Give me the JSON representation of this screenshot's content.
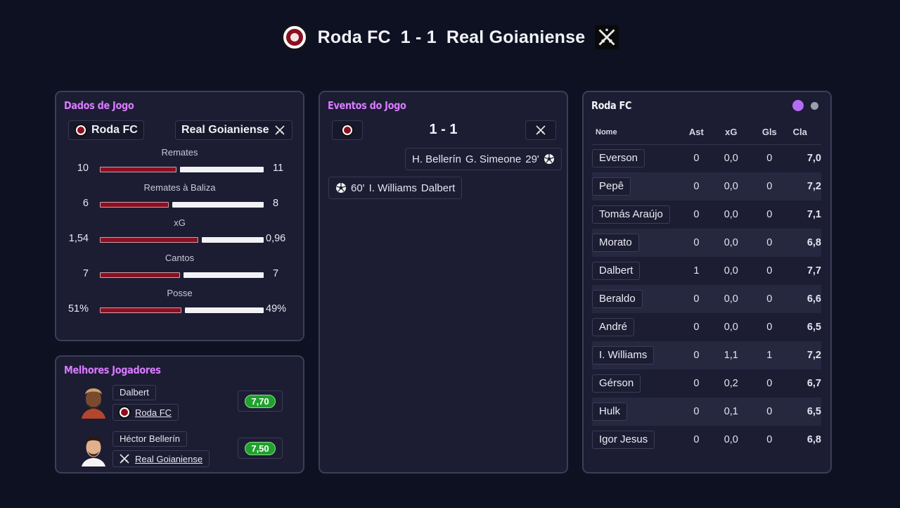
{
  "match": {
    "home": "Roda FC",
    "away": "Real Goianiense",
    "score": "1 - 1"
  },
  "stats_panel": {
    "title": "Dados de Jogo",
    "home_chip": "Roda FC",
    "away_chip": "Real Goianiense",
    "stats": [
      {
        "label": "Remates",
        "home": "10",
        "away": "11",
        "home_share": 0.476
      },
      {
        "label": "Remates à Baliza",
        "home": "6",
        "away": "8",
        "home_share": 0.43
      },
      {
        "label": "xG",
        "home": "1,54",
        "away": "0,96",
        "home_share": 0.616
      },
      {
        "label": "Cantos",
        "home": "7",
        "away": "7",
        "home_share": 0.5
      },
      {
        "label": "Posse",
        "home": "51%",
        "away": "49%",
        "home_share": 0.51
      }
    ]
  },
  "events_panel": {
    "title": "Eventos do Jogo",
    "score": "1 - 1",
    "events": [
      {
        "side": "away",
        "assist": "H. Bellerín",
        "scorer": "G. Simeone",
        "minute": "29'"
      },
      {
        "side": "home",
        "minute": "60'",
        "scorer": "I. Williams",
        "assist": "Dalbert"
      }
    ]
  },
  "best_players": {
    "title": "Melhores Jogadores",
    "players": [
      {
        "name": "Dalbert",
        "club": "Roda FC",
        "rating": "7,70"
      },
      {
        "name": "Héctor Bellerín",
        "club": "Real Goianiense",
        "rating": "7,50"
      }
    ]
  },
  "lineup_panel": {
    "title": "Roda FC",
    "dot_colors": [
      "#b46cf5",
      "#9aa0aa"
    ],
    "columns": [
      "Nome",
      "Ast",
      "xG",
      "Gls",
      "Cla"
    ],
    "rows": [
      {
        "name": "Everson",
        "ast": "0",
        "xg": "0,0",
        "gls": "0",
        "cla": "7,0"
      },
      {
        "name": "Pepê",
        "ast": "0",
        "xg": "0,0",
        "gls": "0",
        "cla": "7,2"
      },
      {
        "name": "Tomás Araújo",
        "ast": "0",
        "xg": "0,0",
        "gls": "0",
        "cla": "7,1"
      },
      {
        "name": "Morato",
        "ast": "0",
        "xg": "0,0",
        "gls": "0",
        "cla": "6,8"
      },
      {
        "name": "Dalbert",
        "ast": "1",
        "xg": "0,0",
        "gls": "0",
        "cla": "7,7"
      },
      {
        "name": "Beraldo",
        "ast": "0",
        "xg": "0,0",
        "gls": "0",
        "cla": "6,6"
      },
      {
        "name": "André",
        "ast": "0",
        "xg": "0,0",
        "gls": "0",
        "cla": "6,5"
      },
      {
        "name": "I. Williams",
        "ast": "0",
        "xg": "1,1",
        "gls": "1",
        "cla": "7,2"
      },
      {
        "name": "Gérson",
        "ast": "0",
        "xg": "0,2",
        "gls": "0",
        "cla": "6,7"
      },
      {
        "name": "Hulk",
        "ast": "0",
        "xg": "0,1",
        "gls": "0",
        "cla": "6,5"
      },
      {
        "name": "Igor Jesus",
        "ast": "0",
        "xg": "0,0",
        "gls": "0",
        "cla": "6,8"
      }
    ]
  },
  "colors": {
    "home_bar": "#8b1022",
    "away_bar": "#f2f2f6",
    "accent_title": "#d97bff",
    "rating_green": "#21a02f"
  },
  "icons": [
    "roda-fc-crest-icon",
    "real-goianiense-crest-icon",
    "soccer-ball-icon"
  ]
}
